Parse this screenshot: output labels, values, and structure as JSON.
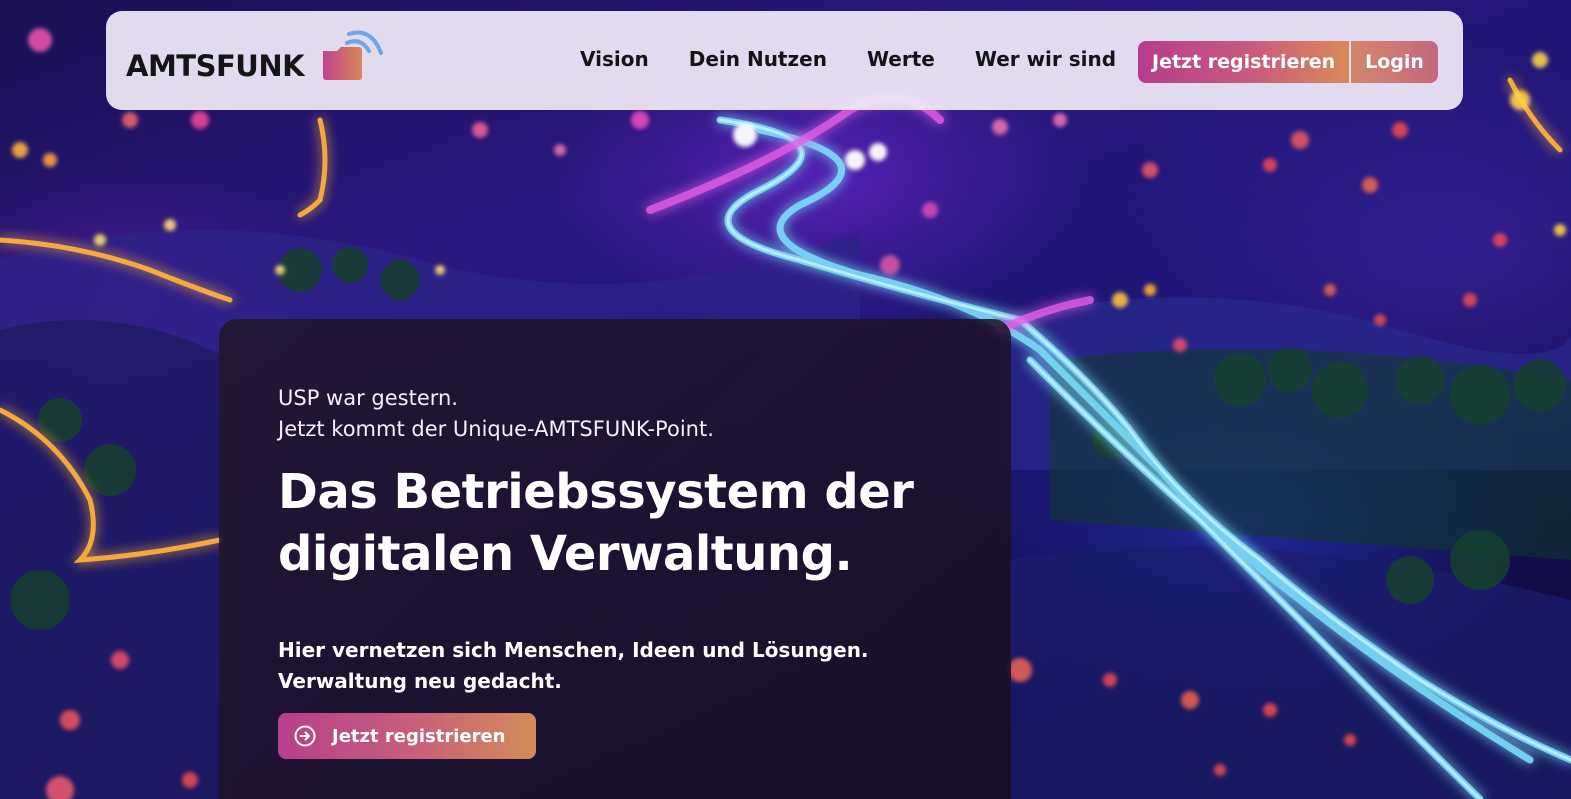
{
  "brand": {
    "name": "AMTSFUNK",
    "accent_pink": "#b53d8f",
    "accent_orange": "#d88a5a",
    "icon": "folder-signal-icon"
  },
  "nav": {
    "links": [
      "Vision",
      "Dein Nutzen",
      "Werte",
      "Wer wir sind"
    ],
    "register_label": "Jetzt registrieren",
    "login_label": "Login"
  },
  "hero": {
    "eyebrow_line1": "USP war gestern.",
    "eyebrow_line2": "Jetzt kommt der Unique-AMTSFUNK-Point.",
    "title_line1": "Das Betriebssystem der",
    "title_line2": "digitalen Verwaltung.",
    "subtitle_line1": "Hier vernetzen sich Menschen, Ideen und Lösungen.",
    "subtitle_line2": "Verwaltung neu gedacht.",
    "cta_label": "Jetzt registrieren",
    "cta_icon": "arrow-circle-right-icon"
  },
  "background": {
    "image": "neon-landscape-illustration"
  }
}
